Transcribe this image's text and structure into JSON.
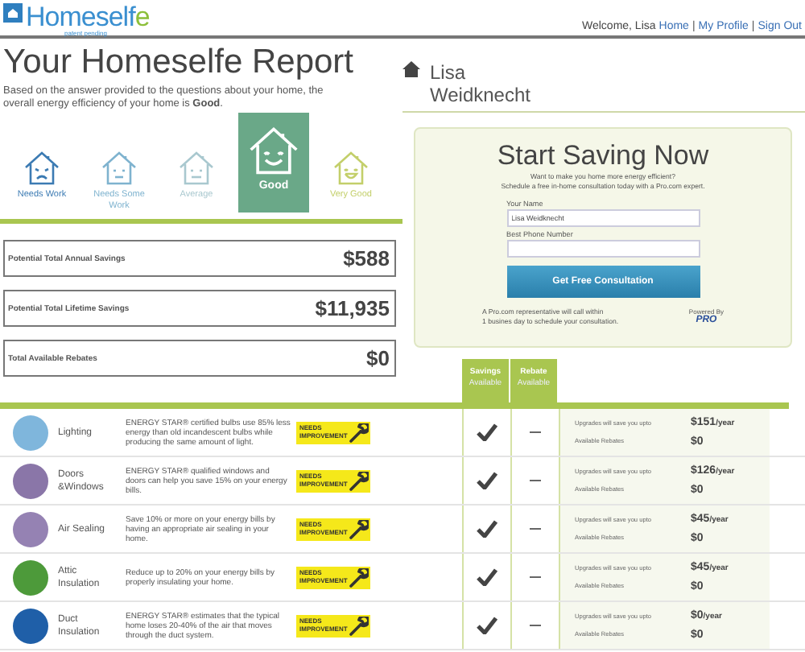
{
  "header": {
    "logo": {
      "text": "Homeself",
      "accent": "e",
      "tagline": "patent pending"
    },
    "welcome": "Welcome, Lisa",
    "links": [
      "Home",
      "My Profile",
      "Sign Out"
    ],
    "separator": "|"
  },
  "report": {
    "title": "Your Homeselfe Report",
    "description": "Based on the answer provided to the questions about your home, the overall energy efficiency of your home is **Good**.",
    "ratings": [
      {
        "label": "Needs Work",
        "kind": "sad",
        "color": "#3c7bb3",
        "selected": false
      },
      {
        "label": "Needs Some Work",
        "kind": "meh",
        "color": "#7fb3cf",
        "selected": false
      },
      {
        "label": "Average",
        "kind": "neutral",
        "color": "#a9c8cf",
        "selected": false
      },
      {
        "label": "Good",
        "kind": "smile",
        "color": "#6aa888",
        "selected": true
      },
      {
        "label": "Very Good",
        "kind": "grin",
        "color": "#c3cf6a",
        "selected": false
      }
    ],
    "totals": [
      {
        "label": "Potential Total Annual Savings",
        "value": "$588"
      },
      {
        "label": "Potential Total Lifetime Savings",
        "value": "$11,935"
      },
      {
        "label": "Total Available Rebates",
        "value": "$0"
      }
    ]
  },
  "user": {
    "name": "Lisa Weidknecht"
  },
  "consultation": {
    "title": "Start Saving Now",
    "intro": [
      "Want to make you home more energy efficient?",
      "Schedule a free in-home consultation today with a Pro.com expert."
    ],
    "fields": [
      {
        "label": "Your Name",
        "value": "Lisa Weidknecht"
      },
      {
        "label": "Best Phone Number"
      }
    ],
    "button": "Get Free Consultation",
    "note": [
      "A Pro.com representative will call within",
      "1 busines day to schedule your consultation."
    ],
    "powered_by": "Powered By",
    "partner": "PRO"
  },
  "table": {
    "columns": [
      {
        "title": "Savings",
        "subtitle": "Available"
      },
      {
        "title": "Rebate",
        "subtitle": "Available"
      }
    ],
    "rows": [
      {
        "name": "Lighting",
        "color": "#7fb6dc",
        "description": "ENERGY STAR® certified bulbs use 85% less energy than old incandescent bulbs while producing the same amount of light.",
        "badge": [
          "NEEDS",
          "IMPROVEMENT"
        ],
        "savings": true,
        "rebate": false,
        "savings_label": "Upgrades will save you upto",
        "amount": "$151",
        "period": "/year",
        "rebates_label": "Available Rebates",
        "rebates": "$0"
      },
      {
        "name": "Doors &Windows",
        "color": "#8a76a8",
        "description": "ENERGY STAR® qualified windows and doors can help you save 15% on your energy bills.",
        "badge": [
          "NEEDS",
          "IMPROVEMENT"
        ],
        "savings": true,
        "rebate": false,
        "savings_label": "Upgrades will save you upto",
        "amount": "$126",
        "period": "/year",
        "rebates_label": "Available Rebates",
        "rebates": "$0"
      },
      {
        "name": "Air Sealing",
        "color": "#9582b3",
        "description": "Save 10% or more on your energy bills by having an appropriate air sealing in your home.",
        "badge": [
          "NEEDS",
          "IMPROVEMENT"
        ],
        "savings": true,
        "rebate": false,
        "savings_label": "Upgrades will save you upto",
        "amount": "$45",
        "period": "/year",
        "rebates_label": "Available Rebates",
        "rebates": "$0"
      },
      {
        "name": "Attic Insulation",
        "color": "#4d9a3a",
        "description": "Reduce up to 20% on your energy bills by properly insulating your home.",
        "badge": [
          "NEEDS",
          "IMPROVEMENT"
        ],
        "savings": true,
        "rebate": false,
        "savings_label": "Upgrades will save you upto",
        "amount": "$45",
        "period": "/year",
        "rebates_label": "Available Rebates",
        "rebates": "$0"
      },
      {
        "name": "Duct Insulation",
        "color": "#1f5fa8",
        "description": "ENERGY STAR® estimates that the typical home loses 20-40% of the air that moves through the duct system.",
        "badge": [
          "NEEDS",
          "IMPROVEMENT"
        ],
        "savings": true,
        "rebate": false,
        "savings_label": "Upgrades will save you upto",
        "amount": "$0",
        "period": "/year",
        "rebates_label": "Available Rebates",
        "rebates": "$0"
      }
    ]
  }
}
